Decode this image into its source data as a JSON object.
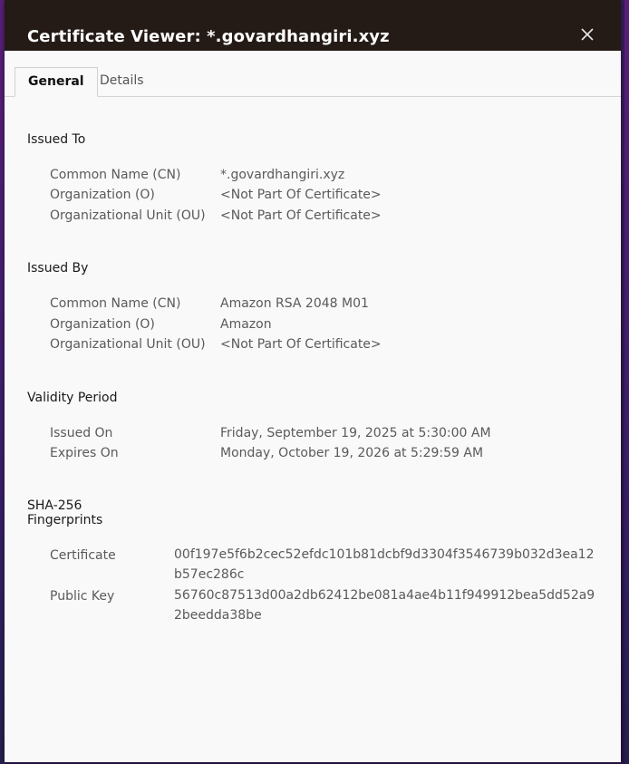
{
  "dialog": {
    "title": "Certificate Viewer: *.govardhangiri.xyz",
    "close_icon": "close-icon"
  },
  "tabs": [
    {
      "label": "General",
      "active": true
    },
    {
      "label": "Details",
      "active": false
    }
  ],
  "issued_to": {
    "heading": "Issued To",
    "rows": [
      {
        "label": "Common Name (CN)",
        "value": "*.govardhangiri.xyz"
      },
      {
        "label": "Organization (O)",
        "value": "<Not Part Of Certificate>"
      },
      {
        "label": "Organizational Unit (OU)",
        "value": "<Not Part Of Certificate>"
      }
    ]
  },
  "issued_by": {
    "heading": "Issued By",
    "rows": [
      {
        "label": "Common Name (CN)",
        "value": "Amazon RSA 2048 M01"
      },
      {
        "label": "Organization (O)",
        "value": "Amazon"
      },
      {
        "label": "Organizational Unit (OU)",
        "value": "<Not Part Of Certificate>"
      }
    ]
  },
  "validity": {
    "heading": "Validity Period",
    "rows": [
      {
        "label": "Issued On",
        "value": "Friday, September 19, 2025 at 5:30:00 AM"
      },
      {
        "label": "Expires On",
        "value": "Monday, October 19, 2026 at 5:29:59 AM"
      }
    ]
  },
  "fingerprints": {
    "heading_line1": "SHA-256",
    "heading_line2": "Fingerprints",
    "rows": [
      {
        "label": "Certificate",
        "value": "00f197e5f6b2cec52efdc101b81dcbf9d3304f3546739b032d3ea12b57ec286c"
      },
      {
        "label": "Public Key",
        "value": "56760c87513d00a2db62412be081a4ae4b11f949912bea5dd52a92beedda38be"
      }
    ]
  }
}
